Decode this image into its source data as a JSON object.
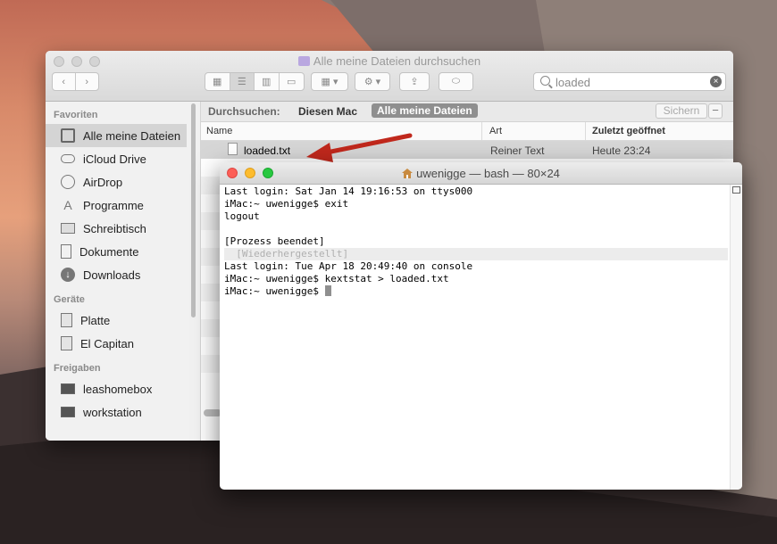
{
  "finder": {
    "title": "Alle meine Dateien durchsuchen",
    "search_value": "loaded",
    "sidebar": {
      "sections": [
        {
          "header": "Favoriten",
          "items": [
            {
              "label": "Alle meine Dateien",
              "icon": "all-files-icon",
              "selected": true
            },
            {
              "label": "iCloud Drive",
              "icon": "cloud-icon"
            },
            {
              "label": "AirDrop",
              "icon": "airdrop-icon"
            },
            {
              "label": "Programme",
              "icon": "applications-icon"
            },
            {
              "label": "Schreibtisch",
              "icon": "desktop-icon"
            },
            {
              "label": "Dokumente",
              "icon": "documents-icon"
            },
            {
              "label": "Downloads",
              "icon": "downloads-icon"
            }
          ]
        },
        {
          "header": "Geräte",
          "items": [
            {
              "label": "Platte",
              "icon": "disk-icon"
            },
            {
              "label": "El Capitan",
              "icon": "disk-icon"
            }
          ]
        },
        {
          "header": "Freigaben",
          "items": [
            {
              "label": "leashomebox",
              "icon": "computer-icon"
            },
            {
              "label": "workstation",
              "icon": "computer-icon"
            }
          ]
        }
      ]
    },
    "scope": {
      "label": "Durchsuchen:",
      "option_this_mac": "Diesen Mac",
      "option_all_files": "Alle meine Dateien",
      "save_label": "Sichern",
      "minus_label": "−"
    },
    "columns": {
      "name": "Name",
      "kind": "Art",
      "last_opened": "Zuletzt geöffnet"
    },
    "results": [
      {
        "name": "loaded.txt",
        "kind": "Reiner Text",
        "last_opened": "Heute 23:24"
      }
    ]
  },
  "terminal": {
    "title": "uwenigge — bash — 80×24",
    "lines": [
      "Last login: Sat Jan 14 19:16:53 on ttys000",
      "iMac:~ uwenigge$ exit",
      "logout",
      "",
      "[Prozess beendet]",
      "  [Wiederhergestellt]",
      "Last login: Tue Apr 18 20:49:40 on console",
      "iMac:~ uwenigge$ kextstat > loaded.txt",
      "iMac:~ uwenigge$ "
    ]
  },
  "colors": {
    "arrow": "#c0281c",
    "close": "#fc5f57",
    "minimize": "#fdbc2e",
    "zoom": "#28c840"
  }
}
